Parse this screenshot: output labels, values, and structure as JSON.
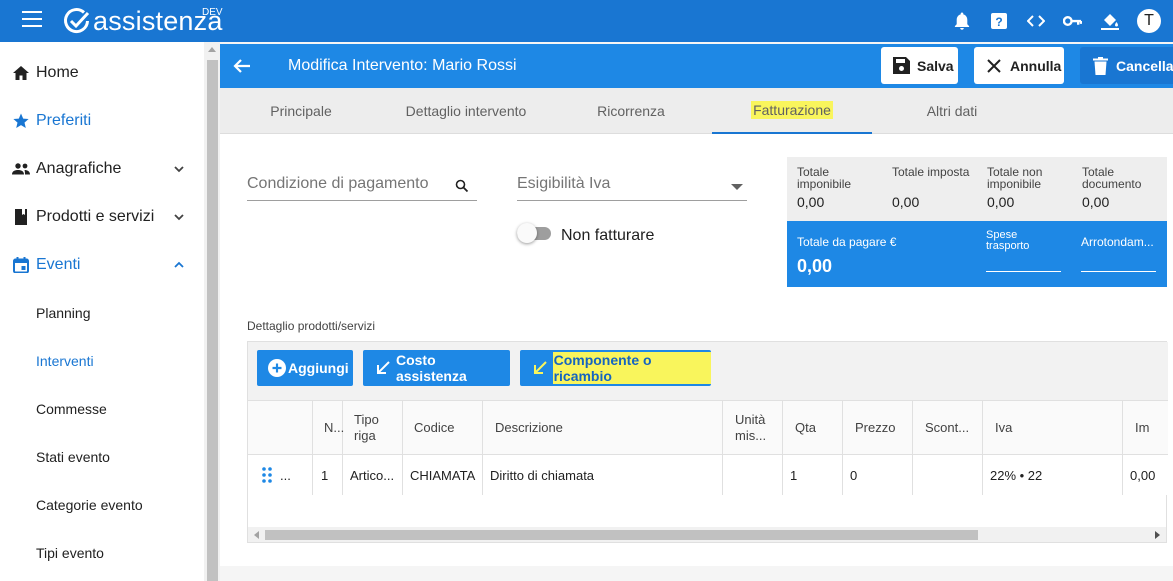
{
  "app": {
    "name": "assistenza",
    "env_badge": "DEV",
    "avatar_letter": "T",
    "top_icons": [
      "bell-icon",
      "help-icon",
      "code-icon",
      "key-icon",
      "paint-bucket-icon"
    ]
  },
  "sidebar": {
    "items": [
      {
        "label": "Home",
        "icon": "home-icon"
      },
      {
        "label": "Preferiti",
        "icon": "star-icon"
      },
      {
        "label": "Anagrafiche",
        "icon": "people-icon"
      },
      {
        "label": "Prodotti e servizi",
        "icon": "book-icon"
      },
      {
        "label": "Eventi",
        "icon": "calendar-icon"
      }
    ],
    "sub_items": [
      {
        "label": "Planning"
      },
      {
        "label": "Interventi"
      },
      {
        "label": "Commesse"
      },
      {
        "label": "Stati evento"
      },
      {
        "label": "Categorie evento"
      },
      {
        "label": "Tipi evento"
      }
    ]
  },
  "header": {
    "title": "Modifica Intervento: Mario Rossi",
    "save_label": "Salva",
    "cancel_label": "Annulla",
    "delete_label": "Cancella"
  },
  "tabs": [
    {
      "label": "Principale"
    },
    {
      "label": "Dettaglio intervento"
    },
    {
      "label": "Ricorrenza"
    },
    {
      "label": "Fatturazione"
    },
    {
      "label": "Altri dati"
    }
  ],
  "form": {
    "payment_condition_placeholder": "Condizione di pagamento",
    "vat_placeholder": "Esigibilità Iva",
    "no_invoice_label": "Non fatturare"
  },
  "totals": {
    "imponibile_label": "Totale imponibile",
    "imponibile_value": "0,00",
    "imposta_label": "Totale imposta",
    "imposta_value": "0,00",
    "non_imponibile_label": "Totale non imponibile",
    "non_imponibile_value": "0,00",
    "documento_label": "Totale documento",
    "documento_value": "0,00",
    "da_pagare_label": "Totale da pagare €",
    "da_pagare_value": "0,00",
    "spese_label": "Spese trasporto",
    "arrotondamento_label": "Arrotondam..."
  },
  "detail": {
    "section_label": "Dettaglio prodotti/servizi",
    "add_label": "Aggiungi",
    "cost_label": "Costo assistenza",
    "component_label": "Componente o ricambio",
    "columns": [
      "N...",
      "Tipo riga",
      "Codice",
      "Descrizione",
      "Unità mis...",
      "Qta",
      "Prezzo",
      "Scont...",
      "Iva",
      "Im"
    ],
    "rows": [
      {
        "handle": "...",
        "n": "1",
        "tipo": "Artico...",
        "codice": "CHIAMATA",
        "descrizione": "Diritto di chiamata",
        "unita": "",
        "qta": "1",
        "prezzo": "0",
        "sconto": "",
        "iva": "22% • 22",
        "importo": "0,00"
      }
    ]
  },
  "colors": {
    "primary": "#1976d2",
    "highlight": "#f9f55c"
  }
}
